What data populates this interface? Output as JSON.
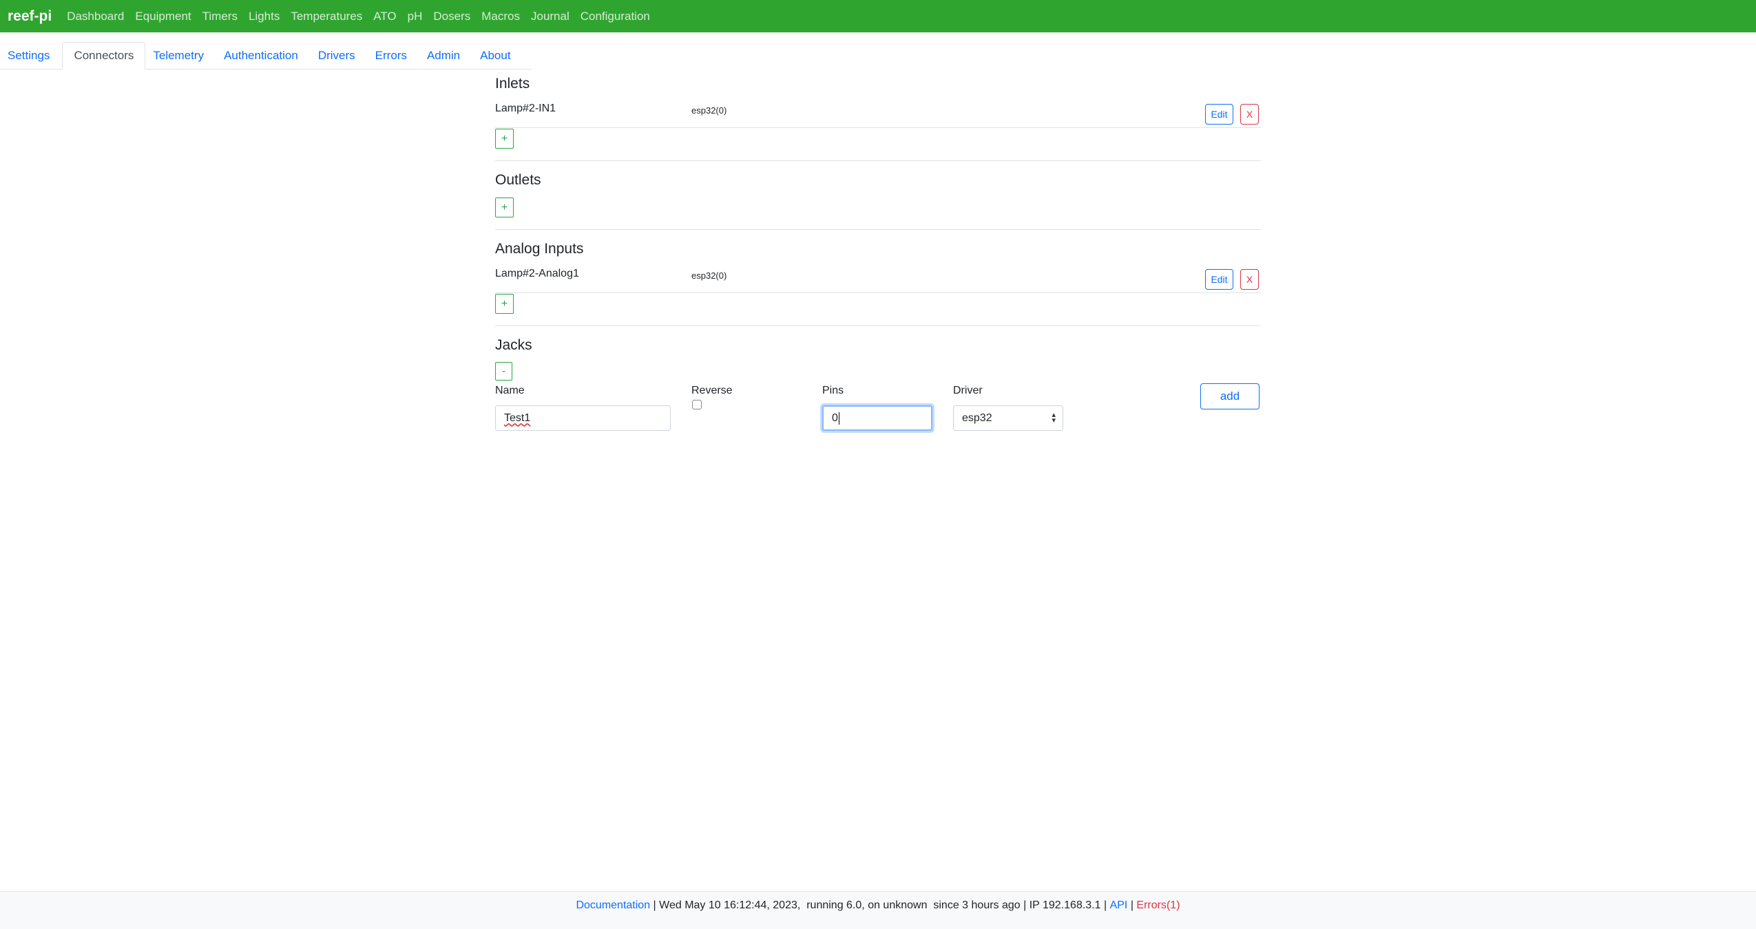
{
  "navbar": {
    "brand": "reef-pi",
    "items": [
      "Dashboard",
      "Equipment",
      "Timers",
      "Lights",
      "Temperatures",
      "ATO",
      "pH",
      "Dosers",
      "Macros",
      "Journal",
      "Configuration"
    ]
  },
  "tabs": [
    "Settings",
    "Connectors",
    "Telemetry",
    "Authentication",
    "Drivers",
    "Errors",
    "Admin",
    "About"
  ],
  "active_tab": "Connectors",
  "inlets": {
    "title": "Inlets",
    "rows": [
      {
        "name": "Lamp#2-IN1",
        "driver": "esp32(0)"
      }
    ],
    "add_label": "+"
  },
  "outlets": {
    "title": "Outlets",
    "add_label": "+"
  },
  "analog_inputs": {
    "title": "Analog Inputs",
    "rows": [
      {
        "name": "Lamp#2-Analog1",
        "driver": "esp32(0)"
      }
    ],
    "add_label": "+"
  },
  "row_buttons": {
    "edit": "Edit",
    "delete": "X"
  },
  "jacks": {
    "title": "Jacks",
    "collapse_label": "-",
    "form": {
      "name_label": "Name",
      "name_value": "Test1",
      "reverse_label": "Reverse",
      "reverse_checked": false,
      "pins_label": "Pins",
      "pins_value": "0",
      "driver_label": "Driver",
      "driver_value": "esp32",
      "add_label": "add"
    }
  },
  "footer": {
    "documentation": "Documentation",
    "sep": " | ",
    "datetime": "Wed May 10 16:12:44, 2023,",
    "running": "running 6.0,",
    "on": "on unknown",
    "since": "since 3 hours ago",
    "ip": "IP 192.168.3.1",
    "api": "API",
    "errors": "Errors(1)"
  },
  "colors": {
    "navbar": "#2fa52f",
    "link": "#0d6efd",
    "danger": "#dc3545",
    "success": "#28a745"
  }
}
